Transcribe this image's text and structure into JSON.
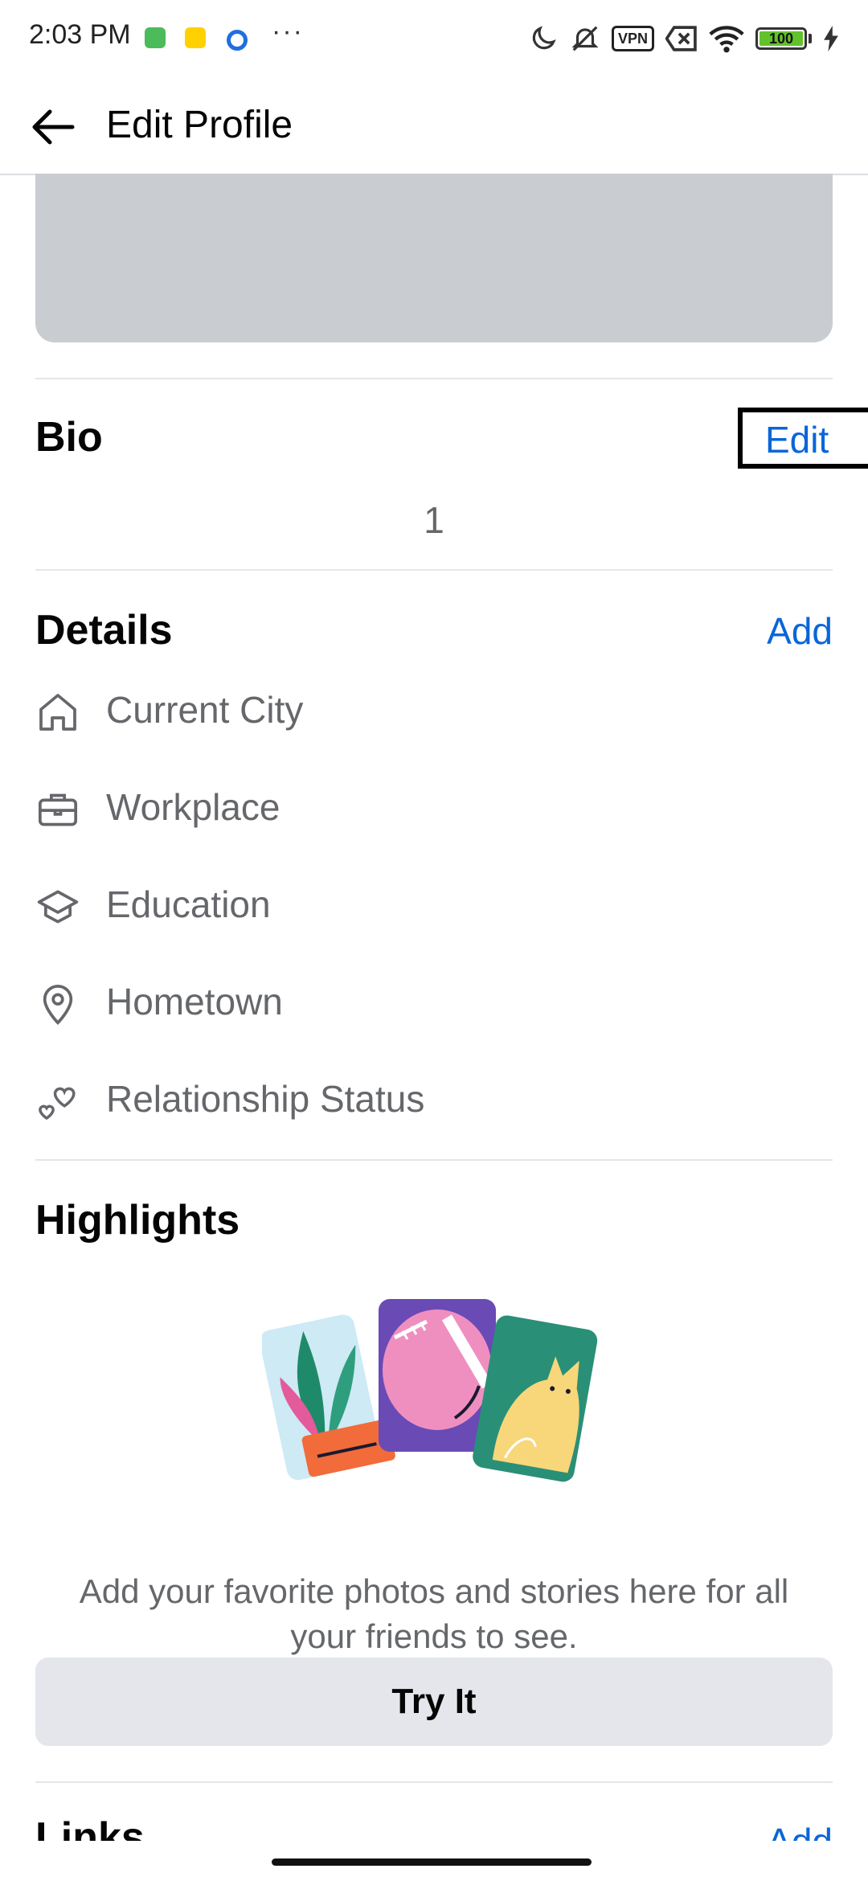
{
  "status_bar": {
    "time": "2:03 PM",
    "more_indicator": "···",
    "app_icons": [
      "green-app-icon",
      "meituan-app-icon",
      "blue-app-icon"
    ],
    "right_icons": [
      "moon-icon",
      "bell-muted-icon",
      "vpn-icon",
      "sim-x-icon",
      "wifi-icon",
      "battery-icon",
      "charging-icon"
    ],
    "vpn_label": "VPN",
    "battery_level": "100"
  },
  "header": {
    "title": "Edit Profile",
    "back_icon": "arrow-left-icon"
  },
  "bio": {
    "title": "Bio",
    "edit_label": "Edit",
    "value": "1"
  },
  "details": {
    "title": "Details",
    "add_label": "Add",
    "items": [
      {
        "label": "Current City",
        "icon": "home-icon"
      },
      {
        "label": "Workplace",
        "icon": "briefcase-icon"
      },
      {
        "label": "Education",
        "icon": "graduation-cap-icon"
      },
      {
        "label": "Hometown",
        "icon": "location-pin-icon"
      },
      {
        "label": "Relationship Status",
        "icon": "hearts-icon"
      }
    ]
  },
  "highlights": {
    "title": "Highlights",
    "description": "Add your favorite photos and stories here for all your friends to see.",
    "button_label": "Try It"
  },
  "links": {
    "title": "Links",
    "add_label": "Add"
  },
  "colors": {
    "link_blue": "#0a66d8",
    "secondary_text": "#65676b",
    "divider": "#e4e6eb",
    "cover_gray": "#c9ccd1",
    "button_gray": "#e4e6eb"
  }
}
